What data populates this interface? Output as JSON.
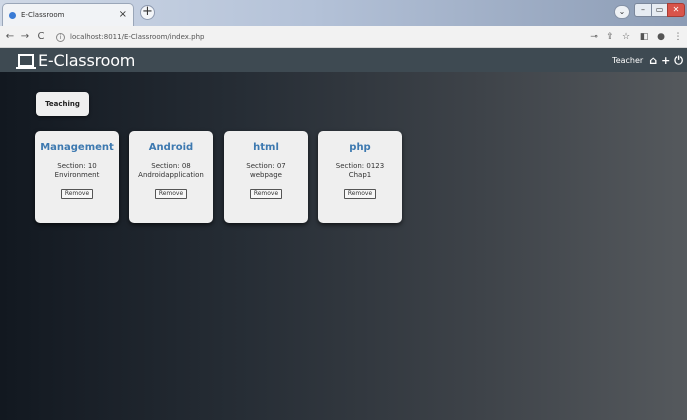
{
  "browser": {
    "tab_title": "E-Classroom",
    "tab_close": "×",
    "new_tab": "+",
    "url": "localhost:8011/E-Classroom/index.php",
    "back": "←",
    "forward": "→",
    "reload": "C",
    "info": "i",
    "profile": "⌄",
    "minimize": "–",
    "maximize": "▭",
    "close": "✕",
    "key_icon": "⊸",
    "share_icon": "⇪",
    "star_icon": "☆",
    "sidepanel_icon": "◧",
    "account_icon": "●",
    "menu_icon": "⋮"
  },
  "navbar": {
    "brand": "E-Classroom",
    "user": "Teacher",
    "home_icon": "⌂",
    "add_icon": "+",
    "power_icon": "⏻"
  },
  "teaching_button": "Teaching",
  "courses": [
    {
      "name": "Management",
      "section": "Section: 10",
      "desc": "Environment",
      "remove": "Remove"
    },
    {
      "name": "Android",
      "section": "Section: 08",
      "desc": "Androidapplication",
      "remove": "Remove"
    },
    {
      "name": "html",
      "section": "Section: 07",
      "desc": "webpage",
      "remove": "Remove"
    },
    {
      "name": "php",
      "section": "Section: 0123",
      "desc": "Chap1",
      "remove": "Remove"
    }
  ]
}
